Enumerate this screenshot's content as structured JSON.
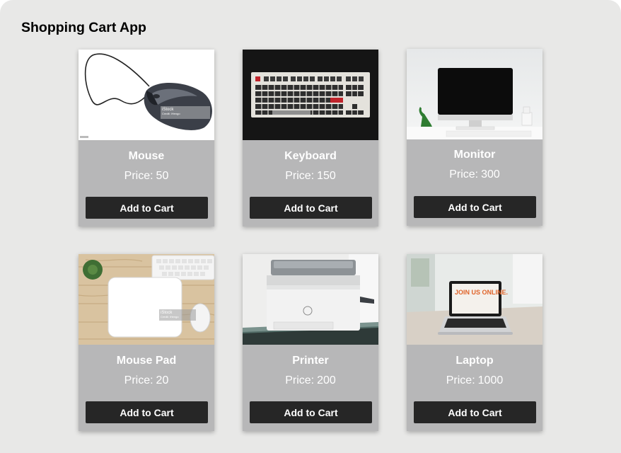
{
  "app": {
    "title": "Shopping Cart App"
  },
  "price_label": "Price:",
  "add_label": "Add to Cart",
  "products": [
    {
      "name": "Mouse",
      "price": "50",
      "image": "mouse-image"
    },
    {
      "name": "Keyboard",
      "price": "150",
      "image": "keyboard-image"
    },
    {
      "name": "Monitor",
      "price": "300",
      "image": "monitor-image"
    },
    {
      "name": "Mouse Pad",
      "price": "20",
      "image": "mouse-pad-image"
    },
    {
      "name": "Printer",
      "price": "200",
      "image": "printer-image"
    },
    {
      "name": "Laptop",
      "price": "1000",
      "image": "laptop-image"
    }
  ],
  "image_text": {
    "stock_mark": "iStock",
    "stock_credit": "Credit: iHengo",
    "laptop_screen": "JOIN US ONLINE."
  },
  "colors": {
    "page_bg": "#e8e8e7",
    "card_bg": "#b7b7b8",
    "button_bg": "#262626",
    "text_light": "#ffffff"
  }
}
